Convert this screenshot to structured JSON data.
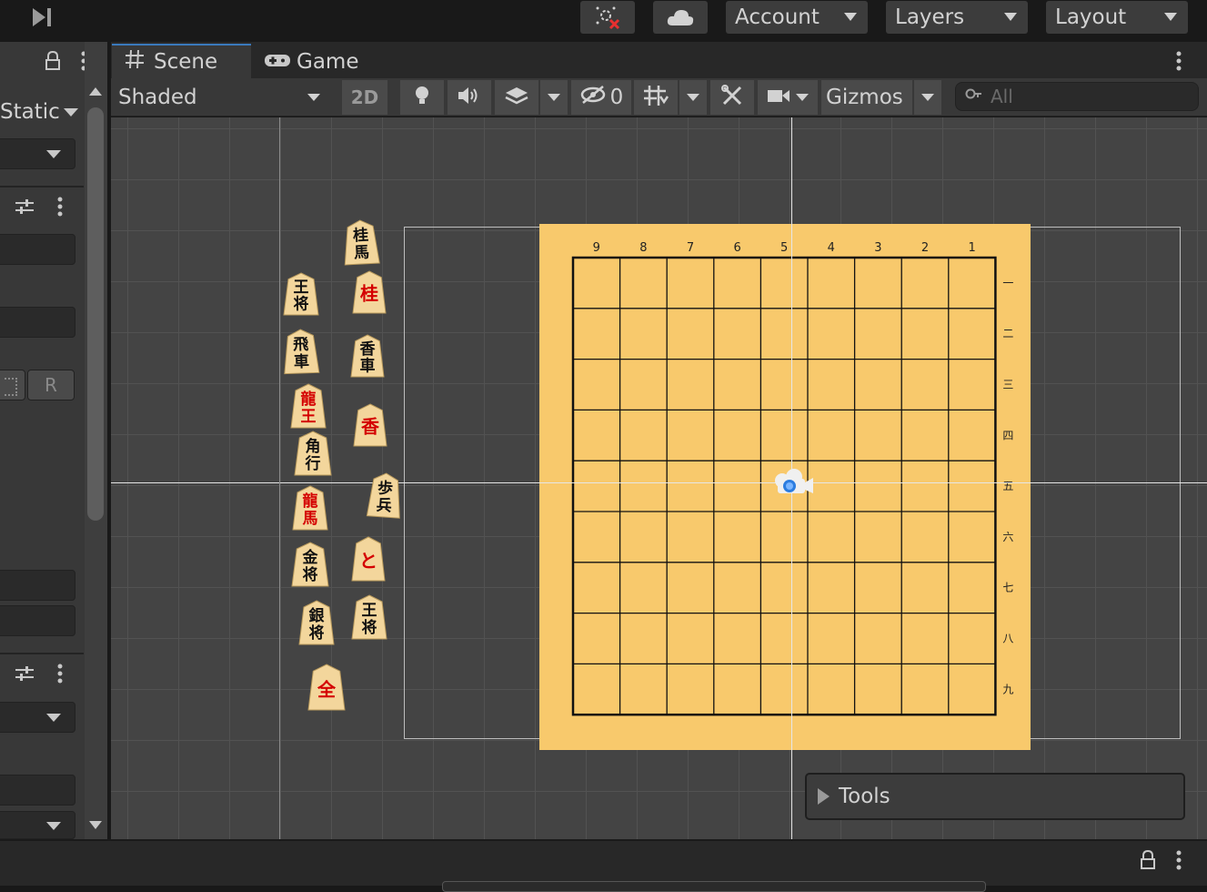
{
  "toolbar": {
    "step_icon": "step-forward-icon",
    "collab_icon": "collab-services-icon",
    "cloud_icon": "cloud-icon",
    "account_label": "Account",
    "layers_label": "Layers",
    "layout_label": "Layout"
  },
  "left_panel": {
    "static_label": "Static",
    "r_button": "R",
    "lock_icon": "lock-icon",
    "more_icon": "kebab-menu-icon",
    "settings_icon": "sliders-icon"
  },
  "tabs": {
    "scene_label": "Scene",
    "scene_icon": "grid-hash-icon",
    "game_label": "Game",
    "game_icon": "gamepad-icon"
  },
  "scene_toolbar": {
    "draw_mode": "Shaded",
    "mode_2d": "2D",
    "hidden_count": "0",
    "gizmos_label": "Gizmos",
    "search_placeholder": "All"
  },
  "board": {
    "col_labels": [
      "9",
      "8",
      "7",
      "6",
      "5",
      "4",
      "3",
      "2",
      "1"
    ],
    "row_labels": [
      "一",
      "二",
      "三",
      "四",
      "五",
      "六",
      "七",
      "八",
      "九"
    ],
    "board_color": "#f8c96c",
    "line_color": "#111111"
  },
  "pieces": [
    {
      "id": "keima",
      "chars": [
        "桂",
        "馬"
      ],
      "color": "#111111"
    },
    {
      "id": "osho-1",
      "chars": [
        "王",
        "将"
      ],
      "color": "#111111"
    },
    {
      "id": "kei-promoted",
      "chars": [
        "桂"
      ],
      "color": "#d40000"
    },
    {
      "id": "hisha",
      "chars": [
        "飛",
        "車"
      ],
      "color": "#111111"
    },
    {
      "id": "kyosha",
      "chars": [
        "香",
        "車"
      ],
      "color": "#111111"
    },
    {
      "id": "ryuo",
      "chars": [
        "龍",
        "王"
      ],
      "color": "#d40000"
    },
    {
      "id": "kyo-promoted",
      "chars": [
        "香"
      ],
      "color": "#d40000"
    },
    {
      "id": "kakugyo",
      "chars": [
        "角",
        "行"
      ],
      "color": "#111111"
    },
    {
      "id": "fuhyo",
      "chars": [
        "歩",
        "兵"
      ],
      "color": "#111111"
    },
    {
      "id": "ryuma",
      "chars": [
        "龍",
        "馬"
      ],
      "color": "#d40000"
    },
    {
      "id": "tokin",
      "chars": [
        "と"
      ],
      "color": "#d40000"
    },
    {
      "id": "kinsho",
      "chars": [
        "金",
        "将"
      ],
      "color": "#111111"
    },
    {
      "id": "osho-2",
      "chars": [
        "王",
        "将"
      ],
      "color": "#111111"
    },
    {
      "id": "ginsho",
      "chars": [
        "銀",
        "将"
      ],
      "color": "#111111"
    },
    {
      "id": "gin-promoted",
      "chars": [
        "全"
      ],
      "color": "#d40000"
    }
  ],
  "tools_overlay": {
    "label": "Tools"
  }
}
